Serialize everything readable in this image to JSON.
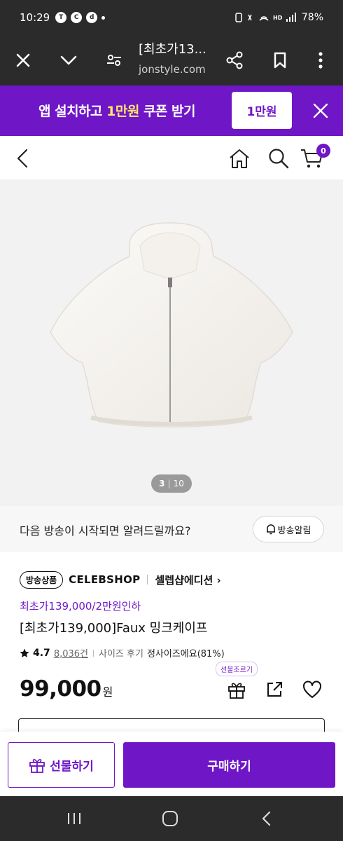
{
  "status_bar": {
    "time": "10:29",
    "notification_icons": [
      "talk-icon",
      "c-icon",
      "discord-icon",
      "dot-icon"
    ],
    "right_icons": [
      "vibrate-icon",
      "mute-icon",
      "wifi-icon",
      "hd-voice-icon",
      "signal-icon"
    ],
    "battery": "78%"
  },
  "browser": {
    "title": "[최초가13...",
    "url": "jonstyle.com"
  },
  "promo_banner": {
    "text_before": "앱 설치하고 ",
    "text_highlight": "1만원",
    "text_after": " 쿠폰 받기",
    "coupon_label": "1만원"
  },
  "header": {
    "cart_count": "0"
  },
  "gallery": {
    "current": "3",
    "divider": "|",
    "total": "10"
  },
  "broadcast": {
    "question": "다음 방송이 시작되면 알려드릴까요?",
    "button": "방송알림"
  },
  "product": {
    "badge": "방송상품",
    "brand": "CELEBSHOP",
    "edition": "셀렙샵에디션 ›",
    "promo_line": "최초가139,000/2만원인하",
    "title": "[최초가139,000]Faux 밍크케이프",
    "rating": "4.7",
    "review_count": "8,036건",
    "size_review_label": "사이즈 후기",
    "size_review_value": "정사이즈에요(81%)",
    "price": "99,000",
    "price_unit": "원",
    "gift_tooltip": "선물조르기"
  },
  "actions": {
    "gift_button": "선물하기",
    "buy_button": "구매하기"
  },
  "colors": {
    "brand_purple": "#6f16c7",
    "highlight_yellow": "#ffe76b",
    "system_bar": "#2b2b2b"
  }
}
